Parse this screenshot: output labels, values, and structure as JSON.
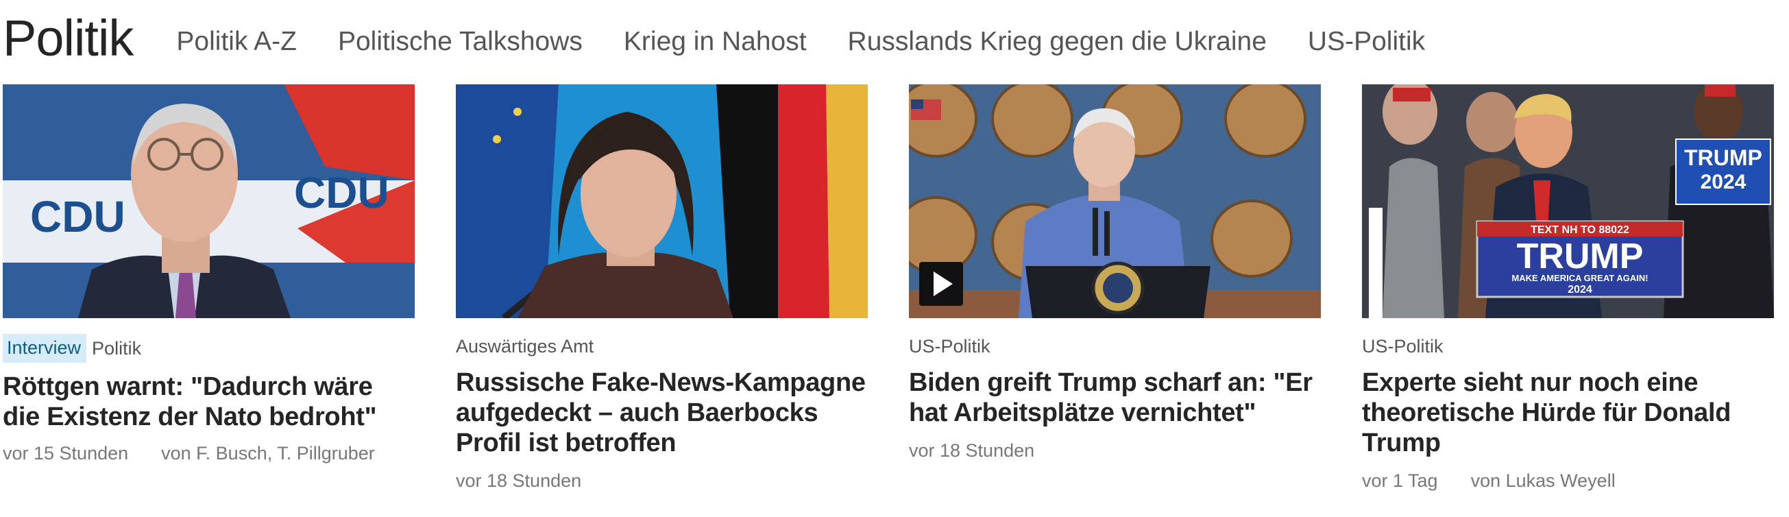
{
  "header": {
    "title": "Politik",
    "nav": [
      {
        "label": "Politik A-Z"
      },
      {
        "label": "Politische Talkshows"
      },
      {
        "label": "Krieg in Nahost"
      },
      {
        "label": "Russlands Krieg gegen die Ukraine"
      },
      {
        "label": "US-Politik"
      }
    ]
  },
  "articles": [
    {
      "badge": "Interview",
      "category": "Politik",
      "headline": "Röttgen warnt: \"Dadurch wäre die Existenz der Nato bedroht\"",
      "time": "vor 15 Stunden",
      "author": "von F. Busch, T. Pillgruber",
      "image_text": [
        "CDU",
        "CDU"
      ]
    },
    {
      "category": "Auswärtiges Amt",
      "headline": "Russische Fake-News-Kampagne aufgedeckt – auch Baerbocks Profil ist betroffen",
      "time": "vor 18 Stunden"
    },
    {
      "category": "US-Politik",
      "headline": "Biden greift Trump scharf an: \"Er hat Arbeitsplätze vernichtet\"",
      "time": "vor 18 Stunden",
      "video": true
    },
    {
      "category": "US-Politik",
      "headline": "Experte sieht nur noch eine theoretische Hürde für Donald Trump",
      "time": "vor 1 Tag",
      "author": "von Lukas Weyell",
      "image_text": [
        "TEXT NH TO 88022",
        "TRUMP",
        "MAKE AMERICA GREAT AGAIN!",
        "2024",
        "TRUMP",
        "2024"
      ]
    }
  ],
  "colors": {
    "badge_bg": "#d7ecf8",
    "badge_text": "#0f5e8a"
  }
}
